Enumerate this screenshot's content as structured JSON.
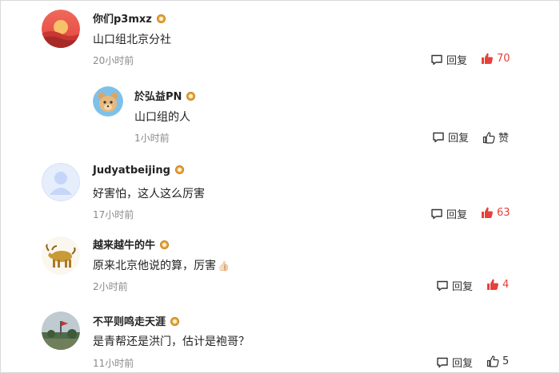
{
  "comments": [
    {
      "user": "你们p3mxz",
      "text": "山口组北京分社",
      "time": "20小时前",
      "reply": "回复",
      "likes": "70",
      "liked": true
    },
    {
      "user": "於弘益PN",
      "text": "山口组的人",
      "time": "1小时前",
      "reply": "回复",
      "likes": "赞",
      "liked": false
    },
    {
      "user": "Judyatbeijing",
      "text": "好害怕，这人这么厉害",
      "time": "17小时前",
      "reply": "回复",
      "likes": "63",
      "liked": true
    },
    {
      "user": "越来越牛的牛",
      "text": "原来北京他说的算，厉害",
      "emoji": "👍🏻",
      "time": "2小时前",
      "reply": "回复",
      "likes": "4",
      "liked": true
    },
    {
      "user": "不平则鸣走天涯",
      "text": "是青帮还是洪门，估计是袍哥？",
      "time": "11小时前",
      "reply": "回复",
      "likes": "5",
      "liked": false
    }
  ],
  "colors": {
    "accent": "#e8403a",
    "muted": "#8a8a8a"
  },
  "icons": {
    "reply": "comment-bubble-icon",
    "like": "thumbs-up-icon",
    "badge": "verified-badge-icon"
  }
}
